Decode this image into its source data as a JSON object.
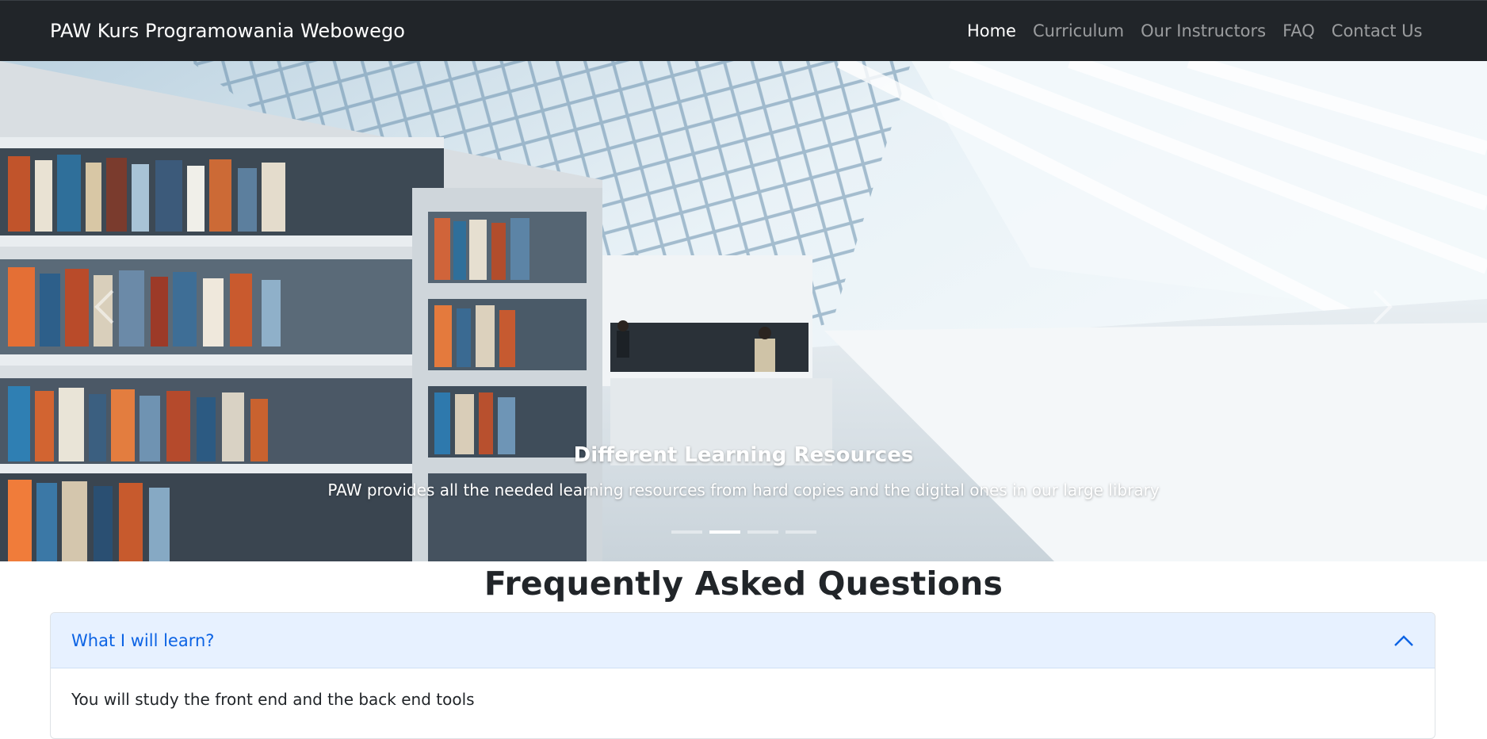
{
  "navbar": {
    "brand": "PAW Kurs Programowania Webowego",
    "links": [
      {
        "label": "Home",
        "active": true
      },
      {
        "label": "Curriculum",
        "active": false
      },
      {
        "label": "Our Instructors",
        "active": false
      },
      {
        "label": "FAQ",
        "active": false
      },
      {
        "label": "Contact Us",
        "active": false
      }
    ]
  },
  "carousel": {
    "caption_title": "Different Learning Resources",
    "caption_text": "PAW provides all the needed learning resources from hard copies and the digital ones in our large library",
    "slide_count": 4,
    "active_index": 1
  },
  "faq": {
    "title": "Frequently Asked Questions",
    "items": [
      {
        "question": "What I will learn?",
        "answer": "You will study the front end and the back end tools",
        "expanded": true
      }
    ]
  },
  "colors": {
    "navbar_bg": "#212529",
    "accordion_active_bg": "#e7f1ff",
    "accordion_active_text": "#0c63e4"
  },
  "icons": {
    "prev": "chevron-left-icon",
    "next": "chevron-right-icon",
    "accordion_toggle": "chevron-up-icon"
  }
}
